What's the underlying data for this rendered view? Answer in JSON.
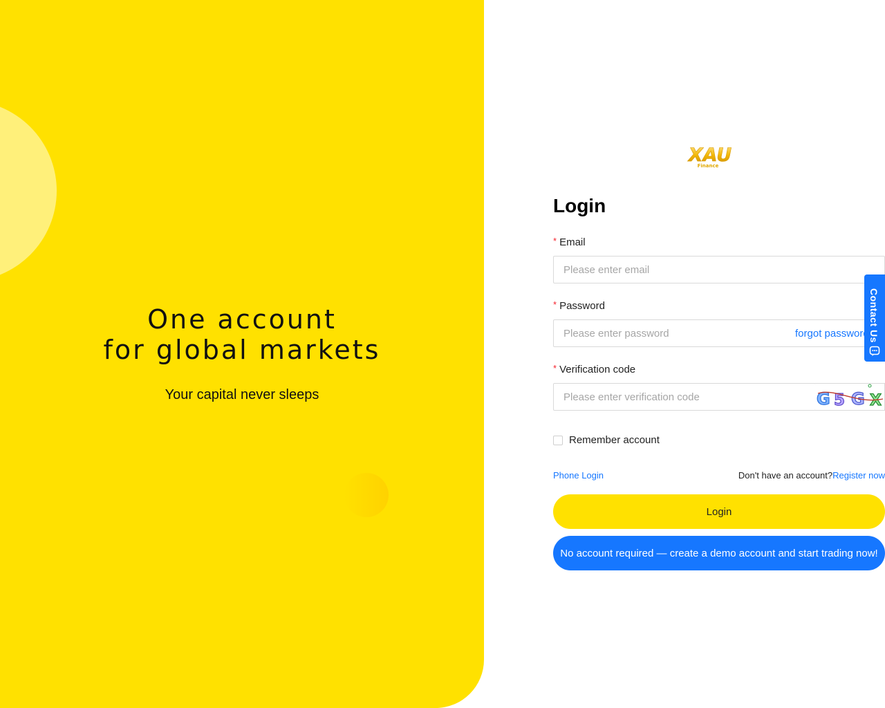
{
  "hero": {
    "title_line1": "One account",
    "title_line2": "for global markets",
    "subtitle": "Your capital never sleeps",
    "colors": {
      "background": "#ffe100",
      "circle": "#fff07a"
    }
  },
  "brand": {
    "logo_icon": "xau-finance-logo",
    "logo_wordmark": "XAU",
    "logo_tagline": "Finance"
  },
  "form": {
    "title": "Login",
    "email": {
      "label": "Email",
      "required_mark": "*",
      "placeholder": "Please enter email",
      "value": ""
    },
    "password": {
      "label": "Password",
      "required_mark": "*",
      "placeholder": "Please enter password",
      "value": "",
      "forgot_label": "forgot password"
    },
    "verification": {
      "label": "Verification code",
      "required_mark": "*",
      "placeholder": "Please enter verification code",
      "value": "",
      "captcha_text": "G5GX"
    },
    "remember": {
      "label": "Remember account",
      "checked": false
    },
    "phone_login_label": "Phone Login",
    "register_prompt": "Don't have an account?",
    "register_link": "Register now",
    "login_button": "Login",
    "demo_button": "No account required — create a demo account and start trading now!"
  },
  "contact_tab": {
    "label": "Contact Us",
    "icon": "chat-bubble-icon"
  },
  "colors": {
    "accent_yellow": "#ffe100",
    "link_blue": "#1677ff",
    "required_red": "#f5222d"
  }
}
